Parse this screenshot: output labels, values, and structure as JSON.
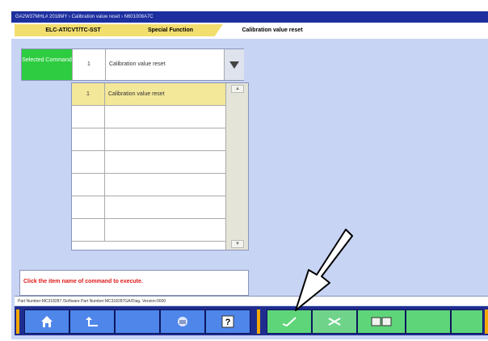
{
  "window": {
    "title": "GA2W37MHL# 2018MY  ›  Calibration value reset  ›  N601008A7C"
  },
  "tabs": [
    {
      "label": "ELC-AT/CVT/TC-SST"
    },
    {
      "label": "Special Function"
    },
    {
      "label": "Calibration value reset"
    }
  ],
  "selected_command": {
    "badge": "Selected Command",
    "number": "1",
    "name": "Calibration value reset"
  },
  "command_list": [
    {
      "number": "1",
      "name": "Calibration value reset"
    },
    {
      "number": "",
      "name": ""
    },
    {
      "number": "",
      "name": ""
    },
    {
      "number": "",
      "name": ""
    },
    {
      "number": "",
      "name": ""
    },
    {
      "number": "",
      "name": ""
    },
    {
      "number": "",
      "name": ""
    }
  ],
  "message": "Click the item name of command to execute.",
  "part_info": "Part Number:MC318287 /Software Part Number:MC318287GA/Diag. Version:0000",
  "toolbar": {
    "buttons": [
      {
        "icon": "home-icon"
      },
      {
        "icon": "back-icon"
      },
      {
        "icon": "blank"
      },
      {
        "icon": "print-icon"
      },
      {
        "icon": "help-icon"
      },
      {
        "icon": "execute-check-icon"
      },
      {
        "icon": "cancel-icon"
      },
      {
        "icon": "data-list-icon"
      }
    ]
  },
  "colors": {
    "title_bar": "#1d2f9e",
    "tab": "#f2de6e",
    "selected_row": "#f3e79a",
    "selected_badge": "#2ecc40",
    "message": "#e01818",
    "toolbar": "#1f2d8f",
    "toolbar_button_blue": "#4f86ea",
    "toolbar_button_green": "#5fd57a",
    "separator": "#f5a800"
  }
}
